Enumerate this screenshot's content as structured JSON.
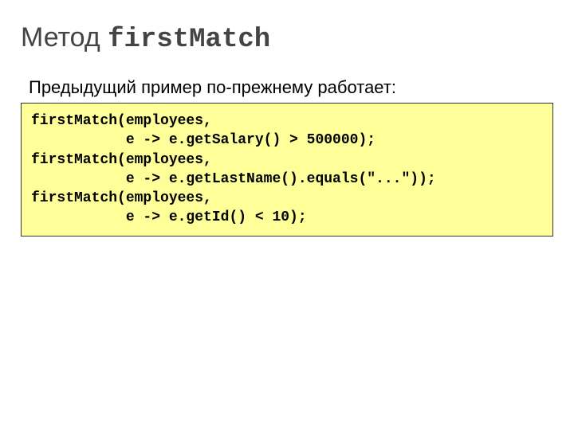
{
  "title": {
    "prefix": "Метод ",
    "method": "firstMatch"
  },
  "subtitle": "Предыдущий пример по-прежнему работает:",
  "code": "firstMatch(employees,\n           e -> e.getSalary() > 500000);\nfirstMatch(employees,\n           e -> e.getLastName().equals(\"...\"));\nfirstMatch(employees,\n           e -> e.getId() < 10);"
}
